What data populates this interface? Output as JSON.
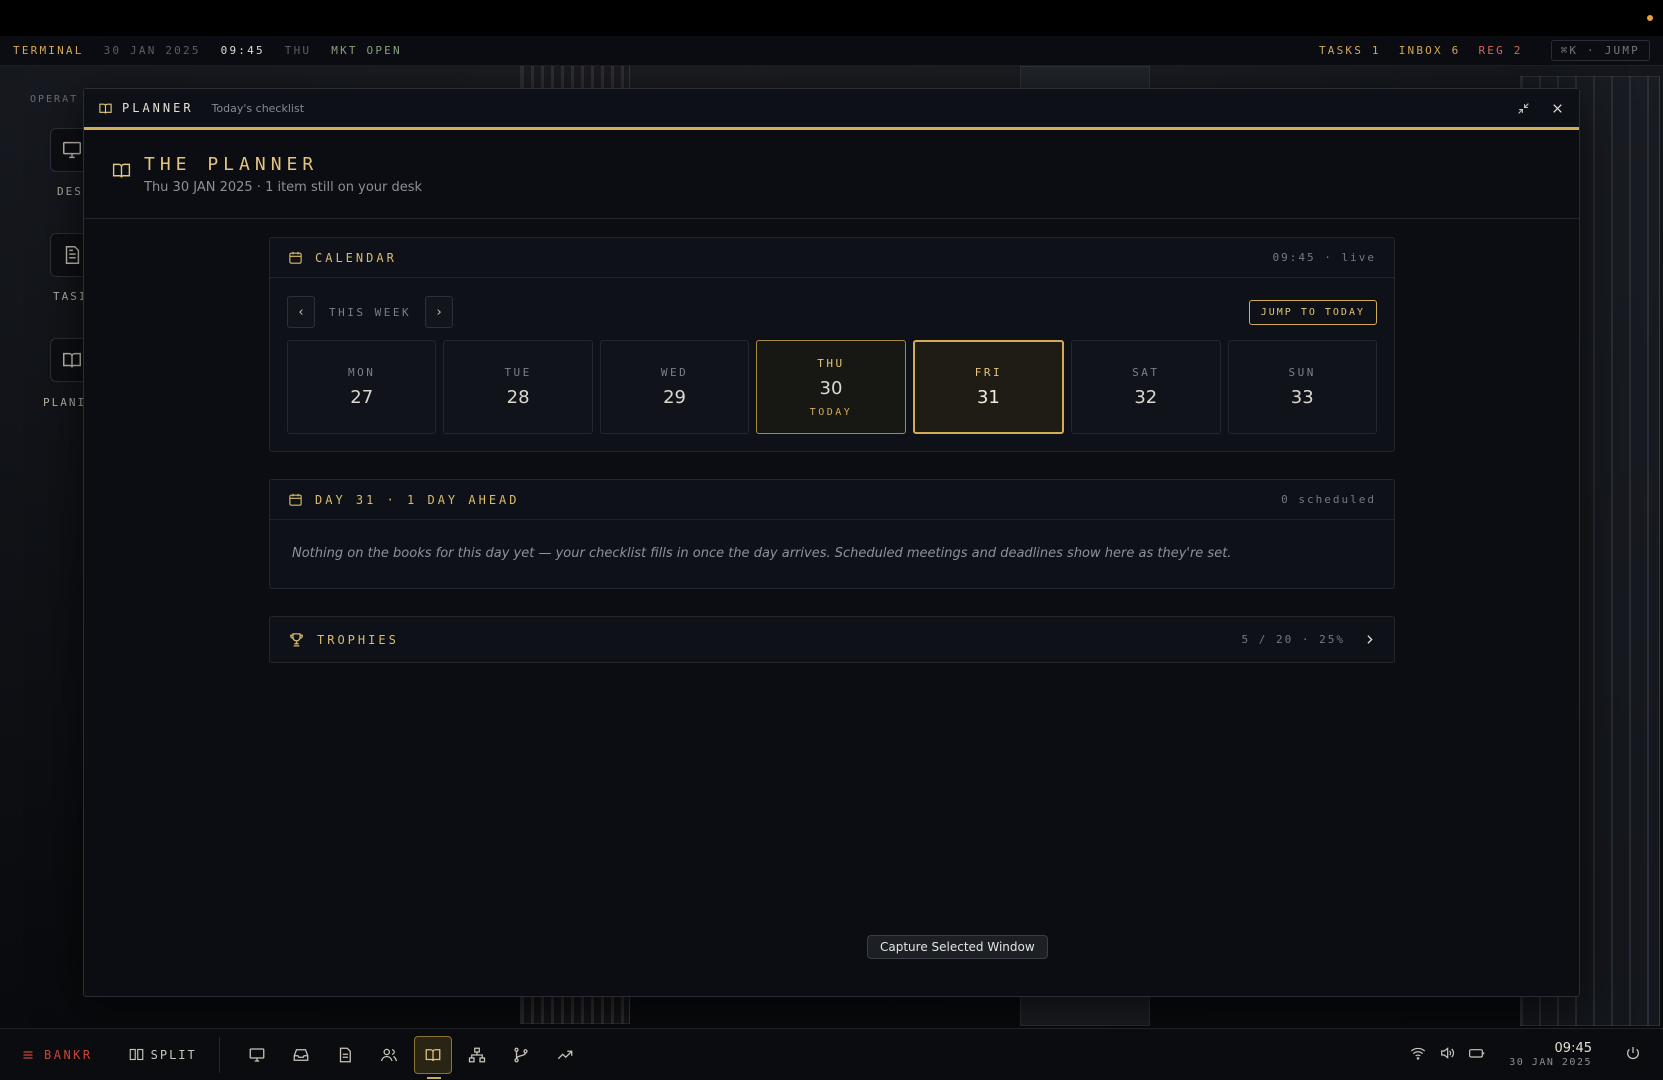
{
  "statusbar": {
    "brand": "TERMINAL",
    "date": "30 JAN 2025",
    "time": "09:45",
    "weekday": "THU",
    "market": "MKT OPEN",
    "tasks": "TASKS 1",
    "inbox": "INBOX 6",
    "reg": "REG 2",
    "jump": "⌘K · JUMP"
  },
  "desktop": {
    "section_label": "OPERAT",
    "tiles": [
      {
        "label": "DES",
        "icon": "monitor-icon"
      },
      {
        "label": "TASI",
        "icon": "document-icon"
      },
      {
        "label": "PLANI",
        "icon": "book-icon"
      }
    ]
  },
  "window": {
    "title": "PLANNER",
    "subtitle": "Today's checklist",
    "header_title": "THE PLANNER",
    "header_sub": "Thu 30 JAN 2025 · 1 item still on your desk"
  },
  "calendar": {
    "title": "CALENDAR",
    "meta": "09:45 · live",
    "week_label": "THIS WEEK",
    "prev": "‹",
    "next": "›",
    "jump_label": "JUMP TO TODAY",
    "days": [
      {
        "name": "MON",
        "num": "27",
        "tag": ""
      },
      {
        "name": "TUE",
        "num": "28",
        "tag": ""
      },
      {
        "name": "WED",
        "num": "29",
        "tag": ""
      },
      {
        "name": "THU",
        "num": "30",
        "tag": "TODAY"
      },
      {
        "name": "FRI",
        "num": "31",
        "tag": ""
      },
      {
        "name": "SAT",
        "num": "32",
        "tag": ""
      },
      {
        "name": "SUN",
        "num": "33",
        "tag": ""
      }
    ]
  },
  "day_panel": {
    "title": "DAY 31 · 1 DAY AHEAD",
    "meta": "0 scheduled",
    "empty": "Nothing on the books for this day yet — your checklist fills in once the day arrives. Scheduled meetings and deadlines show here as they're set."
  },
  "trophies": {
    "title": "TROPHIES",
    "meta": "5 / 20 · 25%"
  },
  "tooltip": "Capture Selected Window",
  "dock": {
    "brand": "BANKR",
    "split": "SPLIT",
    "time": "09:45",
    "date": "30 JAN 2025"
  },
  "colors": {
    "accent": "#d4ab58",
    "accent_light": "#e3c57c",
    "alert": "#c9453a",
    "market": "#8aa37a"
  }
}
